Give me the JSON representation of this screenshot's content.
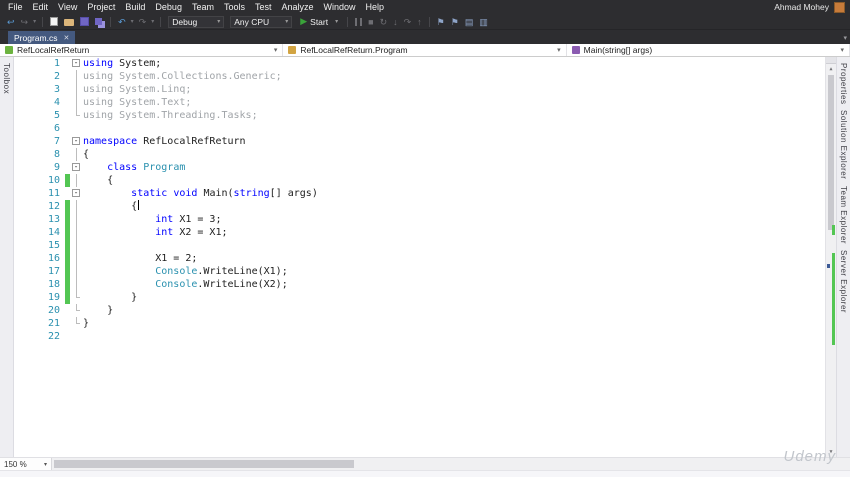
{
  "titlebar": {
    "user": "Ahmad Mohey"
  },
  "menu": {
    "items": [
      "File",
      "Edit",
      "View",
      "Project",
      "Build",
      "Debug",
      "Team",
      "Tools",
      "Test",
      "Analyze",
      "Window",
      "Help"
    ]
  },
  "toolbar": {
    "debug_config": "Debug",
    "platform": "Any CPU",
    "start_label": "Start",
    "items": [
      {
        "t": "icon",
        "n": "nav-backward-icon",
        "g": "↩",
        "cls": "blue"
      },
      {
        "t": "icon",
        "n": "nav-forward-icon",
        "g": "↪",
        "cls": "dim"
      },
      {
        "t": "icon",
        "n": "nav-dropdown-icon",
        "g": "▾",
        "cls": "dim tiny"
      },
      {
        "t": "sep"
      },
      {
        "t": "css",
        "n": "new-file-icon",
        "cls": "ic-new"
      },
      {
        "t": "css",
        "n": "open-file-icon",
        "cls": "ic-folder"
      },
      {
        "t": "css",
        "n": "save-icon",
        "cls": "ic-save"
      },
      {
        "t": "css",
        "n": "save-all-icon",
        "cls": "ic-saveall"
      },
      {
        "t": "sep"
      },
      {
        "t": "icon",
        "n": "undo-icon",
        "g": "↶",
        "cls": "blue"
      },
      {
        "t": "icon",
        "n": "undo-dropdown-icon",
        "g": "▾",
        "cls": "dim tiny"
      },
      {
        "t": "icon",
        "n": "redo-icon",
        "g": "↷",
        "cls": "dim"
      },
      {
        "t": "icon",
        "n": "redo-dropdown-icon",
        "g": "▾",
        "cls": "dim tiny"
      },
      {
        "t": "sep"
      },
      {
        "t": "select",
        "n": "configuration-dropdown",
        "key": "debug_config",
        "w": "w1"
      },
      {
        "t": "select",
        "n": "platform-dropdown",
        "key": "platform",
        "w": "w2"
      },
      {
        "t": "start",
        "n": "start-debugging-button",
        "key": "start_label"
      },
      {
        "t": "sep"
      },
      {
        "t": "css",
        "n": "pause-icon",
        "cls": "ic-pause"
      },
      {
        "t": "icon",
        "n": "stop-icon",
        "g": "■",
        "cls": "dim"
      },
      {
        "t": "icon",
        "n": "restart-icon",
        "g": "↻",
        "cls": "dim"
      },
      {
        "t": "icon",
        "n": "step-into-icon",
        "g": "↓",
        "cls": "dim"
      },
      {
        "t": "icon",
        "n": "step-over-icon",
        "g": "↷",
        "cls": "dim"
      },
      {
        "t": "icon",
        "n": "step-out-icon",
        "g": "↑",
        "cls": "dim"
      },
      {
        "t": "sep"
      },
      {
        "t": "icon",
        "n": "bookmark-icon",
        "g": "⚑",
        "cls": "navy"
      },
      {
        "t": "icon",
        "n": "next-bookmark-icon",
        "g": "⚑",
        "cls": "navy"
      },
      {
        "t": "icon",
        "n": "show-output-icon",
        "g": "▤",
        "cls": "navy"
      },
      {
        "t": "icon",
        "n": "show-properties-icon",
        "g": "▥",
        "cls": "navy"
      }
    ]
  },
  "tab_bar": {
    "tabs": [
      {
        "label": "Program.cs"
      }
    ],
    "close_glyph": "✕",
    "overflow_icon": "▾"
  },
  "breadcrumb": {
    "items": [
      {
        "label": "RefLocalRefReturn",
        "icon": "project-icon",
        "color": "#6cb33f"
      },
      {
        "label": "RefLocalRefReturn.Program",
        "icon": "class-icon",
        "color": "#d2a442"
      },
      {
        "label": "Main(string[] args)",
        "icon": "method-icon",
        "color": "#8b5bb1"
      }
    ]
  },
  "side_panels": {
    "left": [
      {
        "label": "Toolbox"
      }
    ],
    "right": [
      {
        "label": "Properties"
      },
      {
        "label": "Solution Explorer"
      },
      {
        "label": "Team Explorer"
      },
      {
        "label": "Server Explorer"
      }
    ]
  },
  "editor": {
    "zoom_level": "150 %",
    "language": "csharp",
    "lines": [
      {
        "n": 1,
        "fold": "-",
        "changed": false,
        "tokens": [
          [
            "kw",
            "using"
          ],
          [
            "pl",
            " System;"
          ]
        ]
      },
      {
        "n": 2,
        "fold": "|",
        "changed": false,
        "tokens": [
          [
            "gr",
            "using System.Collections.Generic;"
          ]
        ]
      },
      {
        "n": 3,
        "fold": "|",
        "changed": false,
        "tokens": [
          [
            "gr",
            "using System.Linq;"
          ]
        ]
      },
      {
        "n": 4,
        "fold": "|",
        "changed": false,
        "tokens": [
          [
            "gr",
            "using System.Text;"
          ]
        ]
      },
      {
        "n": 5,
        "fold": "L",
        "changed": false,
        "tokens": [
          [
            "gr",
            "using System.Threading.Tasks;"
          ]
        ]
      },
      {
        "n": 6,
        "fold": "",
        "changed": false,
        "tokens": []
      },
      {
        "n": 7,
        "fold": "-",
        "changed": false,
        "tokens": [
          [
            "kw",
            "namespace"
          ],
          [
            "pl",
            " RefLocalRefReturn"
          ]
        ]
      },
      {
        "n": 8,
        "fold": "|",
        "changed": false,
        "tokens": [
          [
            "pl",
            "{"
          ]
        ]
      },
      {
        "n": 9,
        "fold": "-",
        "changed": false,
        "tokens": [
          [
            "pl",
            "    "
          ],
          [
            "kw",
            "class"
          ],
          [
            "ty",
            " Program"
          ]
        ]
      },
      {
        "n": 10,
        "fold": "|",
        "changed": true,
        "tokens": [
          [
            "pl",
            "    {"
          ]
        ]
      },
      {
        "n": 11,
        "fold": "-",
        "changed": false,
        "tokens": [
          [
            "pl",
            "        "
          ],
          [
            "kw",
            "static"
          ],
          [
            "pl",
            " "
          ],
          [
            "kw",
            "void"
          ],
          [
            "pl",
            " Main("
          ],
          [
            "kw",
            "string"
          ],
          [
            "pl",
            "[] args)"
          ]
        ]
      },
      {
        "n": 12,
        "fold": "|",
        "changed": true,
        "tokens": [
          [
            "pl",
            "        {"
          ],
          [
            "caret",
            ""
          ]
        ]
      },
      {
        "n": 13,
        "fold": "|",
        "changed": true,
        "tokens": [
          [
            "pl",
            "            "
          ],
          [
            "kw",
            "int"
          ],
          [
            "pl",
            " X1 = 3;"
          ]
        ]
      },
      {
        "n": 14,
        "fold": "|",
        "changed": true,
        "tokens": [
          [
            "pl",
            "            "
          ],
          [
            "kw",
            "int"
          ],
          [
            "pl",
            " X2 = X1;"
          ]
        ]
      },
      {
        "n": 15,
        "fold": "|",
        "changed": true,
        "tokens": []
      },
      {
        "n": 16,
        "fold": "|",
        "changed": true,
        "tokens": [
          [
            "pl",
            "            X1 = 2;"
          ]
        ]
      },
      {
        "n": 17,
        "fold": "|",
        "changed": true,
        "tokens": [
          [
            "pl",
            "            "
          ],
          [
            "ty",
            "Console"
          ],
          [
            "pl",
            ".WriteLine(X1);"
          ]
        ]
      },
      {
        "n": 18,
        "fold": "|",
        "changed": true,
        "tokens": [
          [
            "pl",
            "            "
          ],
          [
            "ty",
            "Console"
          ],
          [
            "pl",
            ".WriteLine(X2);"
          ]
        ]
      },
      {
        "n": 19,
        "fold": "L",
        "changed": true,
        "tokens": [
          [
            "pl",
            "        }"
          ]
        ]
      },
      {
        "n": 20,
        "fold": "L",
        "changed": false,
        "tokens": [
          [
            "pl",
            "    }"
          ]
        ]
      },
      {
        "n": 21,
        "fold": "L",
        "changed": false,
        "tokens": [
          [
            "pl",
            "}"
          ]
        ]
      },
      {
        "n": 22,
        "fold": "",
        "changed": false,
        "tokens": []
      }
    ]
  },
  "watermark": "Udemy",
  "theme": {
    "keyword": "#0000ff",
    "type": "#2b91af",
    "gray_inactive": "#a0a4a8",
    "line_number": "#2b91af",
    "change_green": "#53c653",
    "chrome": "#2d2d30",
    "tab_active": "#44597f",
    "start_green": "#3aa33a"
  }
}
